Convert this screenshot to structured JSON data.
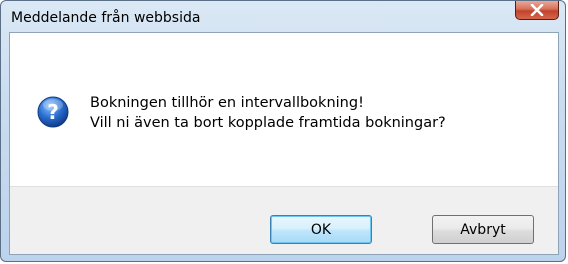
{
  "window": {
    "title": "Meddelande från webbsida"
  },
  "dialog": {
    "icon": "question-icon",
    "message_line1": "Bokningen tillhör en intervallbokning!",
    "message_line2": "Vill ni även ta bort kopplade framtida bokningar?"
  },
  "buttons": {
    "ok_label": "OK",
    "cancel_label": "Avbryt"
  },
  "colors": {
    "titlebar": "#c9dcf0",
    "close_button": "#c7432a",
    "icon_blue": "#1f5fb7",
    "button_bar": "#f0f0f0"
  }
}
